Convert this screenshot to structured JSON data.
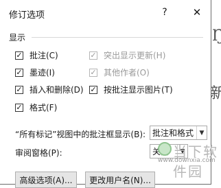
{
  "background": {
    "right_char_1": "Ŋ",
    "right_char_2": "新"
  },
  "dialog": {
    "title": "修订选项",
    "help_label": "?",
    "close_label": "✕"
  },
  "display_section": {
    "label": "显示",
    "checkboxes": [
      {
        "label": "批注(C)",
        "checked": true,
        "enabled": true
      },
      {
        "label": "墨迹(I)",
        "checked": true,
        "enabled": true
      },
      {
        "label": "插入和删除(D)",
        "checked": true,
        "enabled": true
      },
      {
        "label": "格式(F)",
        "checked": true,
        "enabled": true
      },
      {
        "label": "突出显示更新(H)",
        "checked": true,
        "enabled": false
      },
      {
        "label": "其他作者(O)",
        "checked": true,
        "enabled": false
      },
      {
        "label": "按批注显示图片(T)",
        "checked": true,
        "enabled": true
      }
    ]
  },
  "balloons": {
    "label": "“所有标记”视图中的批注框显示(B):",
    "value": "批注和格式"
  },
  "review_pane": {
    "label": "审阅窗格(P):",
    "value": "关闭"
  },
  "buttons": {
    "advanced": "高级选项(A)...",
    "change_user": "更改用户名(N)..."
  },
  "watermark": {
    "text": "当下软件园",
    "url": "www.downxia.com"
  }
}
